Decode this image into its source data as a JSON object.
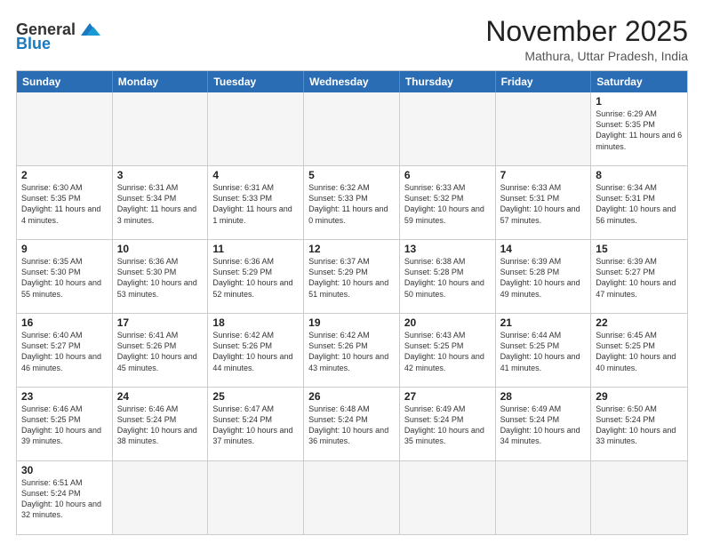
{
  "logo": {
    "text_general": "General",
    "text_blue": "Blue"
  },
  "title": "November 2025",
  "location": "Mathura, Uttar Pradesh, India",
  "days_of_week": [
    "Sunday",
    "Monday",
    "Tuesday",
    "Wednesday",
    "Thursday",
    "Friday",
    "Saturday"
  ],
  "weeks": [
    [
      {
        "day": "",
        "empty": true
      },
      {
        "day": "",
        "empty": true
      },
      {
        "day": "",
        "empty": true
      },
      {
        "day": "",
        "empty": true
      },
      {
        "day": "",
        "empty": true
      },
      {
        "day": "",
        "empty": true
      },
      {
        "day": "1",
        "sunrise": "6:29 AM",
        "sunset": "5:35 PM",
        "daylight": "11 hours and 6 minutes."
      }
    ],
    [
      {
        "day": "2",
        "sunrise": "6:30 AM",
        "sunset": "5:35 PM",
        "daylight": "11 hours and 4 minutes."
      },
      {
        "day": "3",
        "sunrise": "6:31 AM",
        "sunset": "5:34 PM",
        "daylight": "11 hours and 3 minutes."
      },
      {
        "day": "4",
        "sunrise": "6:31 AM",
        "sunset": "5:33 PM",
        "daylight": "11 hours and 1 minute."
      },
      {
        "day": "5",
        "sunrise": "6:32 AM",
        "sunset": "5:33 PM",
        "daylight": "11 hours and 0 minutes."
      },
      {
        "day": "6",
        "sunrise": "6:33 AM",
        "sunset": "5:32 PM",
        "daylight": "10 hours and 59 minutes."
      },
      {
        "day": "7",
        "sunrise": "6:33 AM",
        "sunset": "5:31 PM",
        "daylight": "10 hours and 57 minutes."
      },
      {
        "day": "8",
        "sunrise": "6:34 AM",
        "sunset": "5:31 PM",
        "daylight": "10 hours and 56 minutes."
      }
    ],
    [
      {
        "day": "9",
        "sunrise": "6:35 AM",
        "sunset": "5:30 PM",
        "daylight": "10 hours and 55 minutes."
      },
      {
        "day": "10",
        "sunrise": "6:36 AM",
        "sunset": "5:30 PM",
        "daylight": "10 hours and 53 minutes."
      },
      {
        "day": "11",
        "sunrise": "6:36 AM",
        "sunset": "5:29 PM",
        "daylight": "10 hours and 52 minutes."
      },
      {
        "day": "12",
        "sunrise": "6:37 AM",
        "sunset": "5:29 PM",
        "daylight": "10 hours and 51 minutes."
      },
      {
        "day": "13",
        "sunrise": "6:38 AM",
        "sunset": "5:28 PM",
        "daylight": "10 hours and 50 minutes."
      },
      {
        "day": "14",
        "sunrise": "6:39 AM",
        "sunset": "5:28 PM",
        "daylight": "10 hours and 49 minutes."
      },
      {
        "day": "15",
        "sunrise": "6:39 AM",
        "sunset": "5:27 PM",
        "daylight": "10 hours and 47 minutes."
      }
    ],
    [
      {
        "day": "16",
        "sunrise": "6:40 AM",
        "sunset": "5:27 PM",
        "daylight": "10 hours and 46 minutes."
      },
      {
        "day": "17",
        "sunrise": "6:41 AM",
        "sunset": "5:26 PM",
        "daylight": "10 hours and 45 minutes."
      },
      {
        "day": "18",
        "sunrise": "6:42 AM",
        "sunset": "5:26 PM",
        "daylight": "10 hours and 44 minutes."
      },
      {
        "day": "19",
        "sunrise": "6:42 AM",
        "sunset": "5:26 PM",
        "daylight": "10 hours and 43 minutes."
      },
      {
        "day": "20",
        "sunrise": "6:43 AM",
        "sunset": "5:25 PM",
        "daylight": "10 hours and 42 minutes."
      },
      {
        "day": "21",
        "sunrise": "6:44 AM",
        "sunset": "5:25 PM",
        "daylight": "10 hours and 41 minutes."
      },
      {
        "day": "22",
        "sunrise": "6:45 AM",
        "sunset": "5:25 PM",
        "daylight": "10 hours and 40 minutes."
      }
    ],
    [
      {
        "day": "23",
        "sunrise": "6:46 AM",
        "sunset": "5:25 PM",
        "daylight": "10 hours and 39 minutes."
      },
      {
        "day": "24",
        "sunrise": "6:46 AM",
        "sunset": "5:24 PM",
        "daylight": "10 hours and 38 minutes."
      },
      {
        "day": "25",
        "sunrise": "6:47 AM",
        "sunset": "5:24 PM",
        "daylight": "10 hours and 37 minutes."
      },
      {
        "day": "26",
        "sunrise": "6:48 AM",
        "sunset": "5:24 PM",
        "daylight": "10 hours and 36 minutes."
      },
      {
        "day": "27",
        "sunrise": "6:49 AM",
        "sunset": "5:24 PM",
        "daylight": "10 hours and 35 minutes."
      },
      {
        "day": "28",
        "sunrise": "6:49 AM",
        "sunset": "5:24 PM",
        "daylight": "10 hours and 34 minutes."
      },
      {
        "day": "29",
        "sunrise": "6:50 AM",
        "sunset": "5:24 PM",
        "daylight": "10 hours and 33 minutes."
      }
    ],
    [
      {
        "day": "30",
        "sunrise": "6:51 AM",
        "sunset": "5:24 PM",
        "daylight": "10 hours and 32 minutes."
      },
      {
        "day": "",
        "empty": true
      },
      {
        "day": "",
        "empty": true
      },
      {
        "day": "",
        "empty": true
      },
      {
        "day": "",
        "empty": true
      },
      {
        "day": "",
        "empty": true
      },
      {
        "day": "",
        "empty": true
      }
    ]
  ],
  "colors": {
    "header_bg": "#2a6db5",
    "header_text": "#ffffff",
    "border": "#cccccc",
    "empty_bg": "#f5f5f5"
  }
}
